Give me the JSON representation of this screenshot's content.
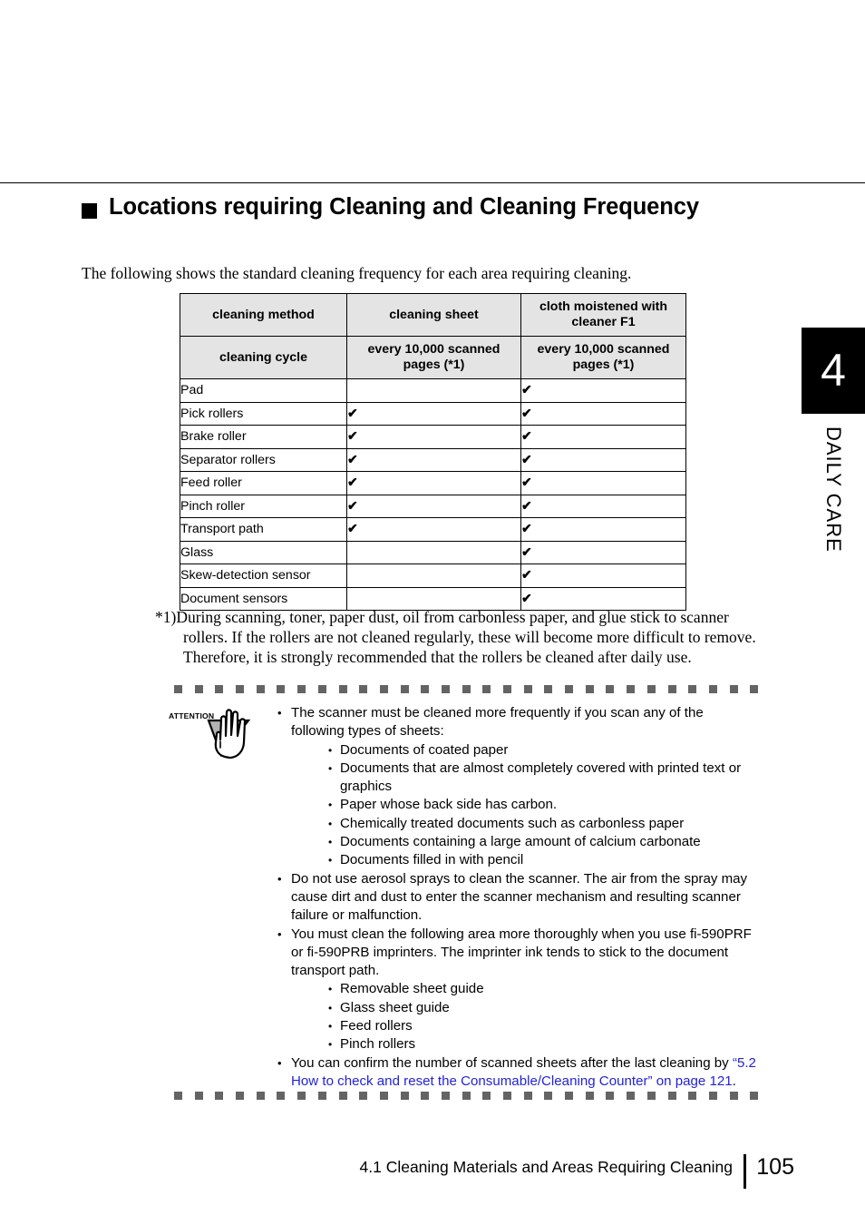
{
  "section": {
    "heading": "Locations requiring Cleaning and Cleaning Frequency",
    "intro": "The following shows the standard cleaning frequency for each area requiring cleaning."
  },
  "table": {
    "header_rows": [
      [
        "cleaning method",
        "cleaning sheet",
        "cloth moistened with cleaner F1"
      ],
      [
        "cleaning cycle",
        "every 10,000 scanned pages (*1)",
        "every 10,000 scanned pages (*1)"
      ]
    ],
    "check_glyph": "✔",
    "rows": [
      {
        "label": "Pad",
        "cleaning_sheet": false,
        "cloth_f1": true
      },
      {
        "label": "Pick rollers",
        "cleaning_sheet": true,
        "cloth_f1": true
      },
      {
        "label": "Brake roller",
        "cleaning_sheet": true,
        "cloth_f1": true
      },
      {
        "label": "Separator rollers",
        "cleaning_sheet": true,
        "cloth_f1": true
      },
      {
        "label": "Feed roller",
        "cleaning_sheet": true,
        "cloth_f1": true
      },
      {
        "label": "Pinch roller",
        "cleaning_sheet": true,
        "cloth_f1": true
      },
      {
        "label": "Transport path",
        "cleaning_sheet": true,
        "cloth_f1": true
      },
      {
        "label": "Glass",
        "cleaning_sheet": false,
        "cloth_f1": true
      },
      {
        "label": "Skew-detection sensor",
        "cleaning_sheet": false,
        "cloth_f1": true
      },
      {
        "label": "Document sensors",
        "cleaning_sheet": false,
        "cloth_f1": true
      }
    ]
  },
  "footnote": {
    "line1": "*1)During scanning, toner, paper dust, oil from carbonless paper, and glue stick to scanner",
    "line2": "rollers. If the rollers are not cleaned regularly, these will become more difficult to remove.",
    "line3": "Therefore, it is strongly recommended that the rollers be cleaned after daily use."
  },
  "attention": {
    "label": "ATTENTION",
    "items": [
      {
        "level": 1,
        "text": "The scanner must be cleaned more frequently if you scan any of the following types of sheets:"
      },
      {
        "level": 2,
        "text": "Documents of coated paper"
      },
      {
        "level": 2,
        "text": "Documents that are almost completely covered with printed text or graphics"
      },
      {
        "level": 2,
        "text": "Paper whose back side has carbon."
      },
      {
        "level": 2,
        "text": "Chemically treated documents such as carbonless paper"
      },
      {
        "level": 2,
        "text": "Documents containing a large amount of calcium carbonate"
      },
      {
        "level": 2,
        "text": "Documents filled in with pencil"
      },
      {
        "level": 1,
        "text": "Do not use aerosol sprays to clean the scanner. The air from the spray may cause dirt and dust to enter the scanner mechanism and resulting scanner failure or malfunction."
      },
      {
        "level": 1,
        "text": "You must clean the following area more thoroughly when you use fi-590PRF or fi-590PRB imprinters. The imprinter ink tends to stick to the document transport path."
      },
      {
        "level": 2,
        "text": "Removable sheet guide"
      },
      {
        "level": 2,
        "text": "Glass sheet guide"
      },
      {
        "level": 2,
        "text": "Feed rollers"
      },
      {
        "level": 2,
        "text": "Pinch rollers"
      }
    ],
    "last_item": {
      "before": "You can confirm the number of scanned sheets after the last cleaning by ",
      "link": "“5.2 How to check and reset the Consumable/Cleaning Counter” on page 121",
      "after": "."
    },
    "link_color": "#2222dd"
  },
  "side_tab": {
    "number": "4",
    "label": "DAILY CARE",
    "background": "#000000",
    "text_color": "#ffffff"
  },
  "footer": {
    "title": "4.1 Cleaning Materials and Areas Requiring Cleaning",
    "page_number": "105"
  }
}
